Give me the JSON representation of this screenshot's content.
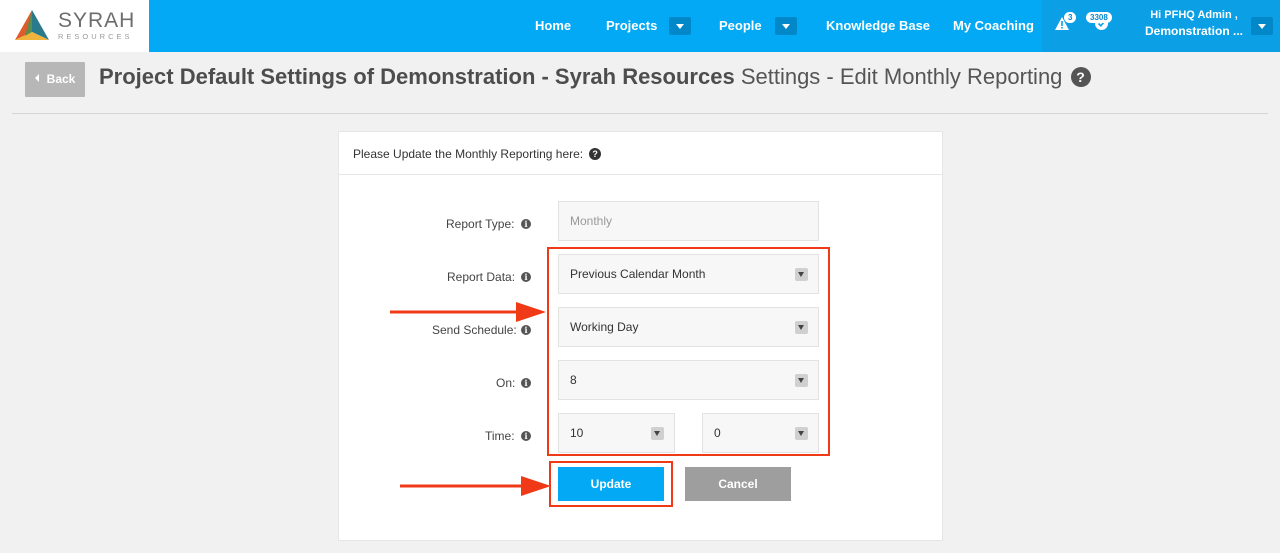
{
  "brand": {
    "name": "SYRAH",
    "tagline": "RESOURCES"
  },
  "nav": {
    "items": [
      "Home",
      "Projects",
      "People",
      "Knowledge Base",
      "My Coaching"
    ],
    "alerts_count": "3",
    "notifications_count": "3308",
    "user_greeting": "Hi PFHQ Admin ,",
    "user_org": "Demonstration ..."
  },
  "header": {
    "back_label": "Back",
    "title_bold": "Project Default Settings of Demonstration - Syrah Resources",
    "title_rest": " Settings - Edit Monthly Reporting",
    "help_glyph": "?"
  },
  "panel": {
    "heading": "Please Update the Monthly Reporting here:",
    "help_glyph": "?"
  },
  "form": {
    "report_type": {
      "label": "Report Type:",
      "value": "Monthly"
    },
    "report_data": {
      "label": "Report Data:",
      "value": "Previous Calendar Month"
    },
    "send_schedule": {
      "label": "Send Schedule:",
      "value": "Working Day"
    },
    "on": {
      "label": "On:",
      "value": "8"
    },
    "time": {
      "label": "Time:",
      "hour": "10",
      "minute": "0"
    },
    "info_glyph": "i"
  },
  "actions": {
    "update_label": "Update",
    "cancel_label": "Cancel"
  },
  "colors": {
    "nav_blue": "#03a9f4",
    "highlight_red": "#f03a17",
    "cancel_gray": "#9e9e9e"
  }
}
